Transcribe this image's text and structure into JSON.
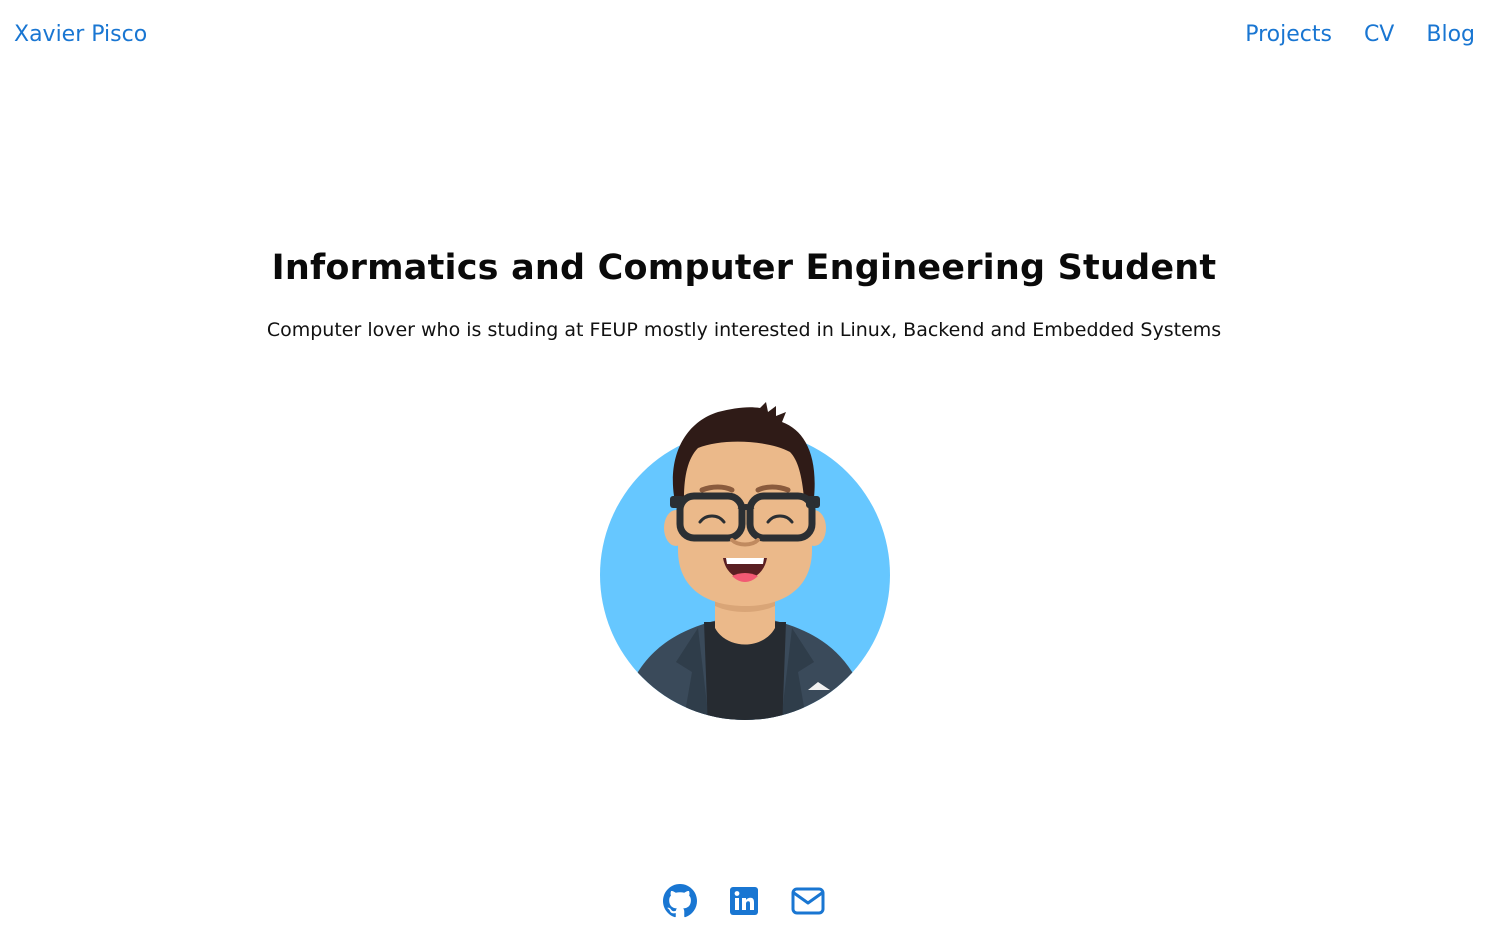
{
  "header": {
    "brand": "Xavier Pisco",
    "nav": [
      {
        "label": "Projects"
      },
      {
        "label": "CV"
      },
      {
        "label": "Blog"
      }
    ]
  },
  "hero": {
    "title": "Informatics and Computer Engineering Student",
    "subtitle": "Computer lover who is studing at FEUP mostly interested in Linux, Backend and Embedded Systems"
  },
  "avatar": {
    "icon": "cartoon-avatar-icon"
  },
  "social": [
    {
      "icon": "github-icon"
    },
    {
      "icon": "linkedin-icon"
    },
    {
      "icon": "email-icon"
    }
  ],
  "colors": {
    "link": "#1976d2",
    "avatar_bg": "#66c7ff",
    "skin": "#ebb98a",
    "hair": "#2f1b17",
    "jacket": "#3a4a5a",
    "shirt": "#262b31"
  }
}
